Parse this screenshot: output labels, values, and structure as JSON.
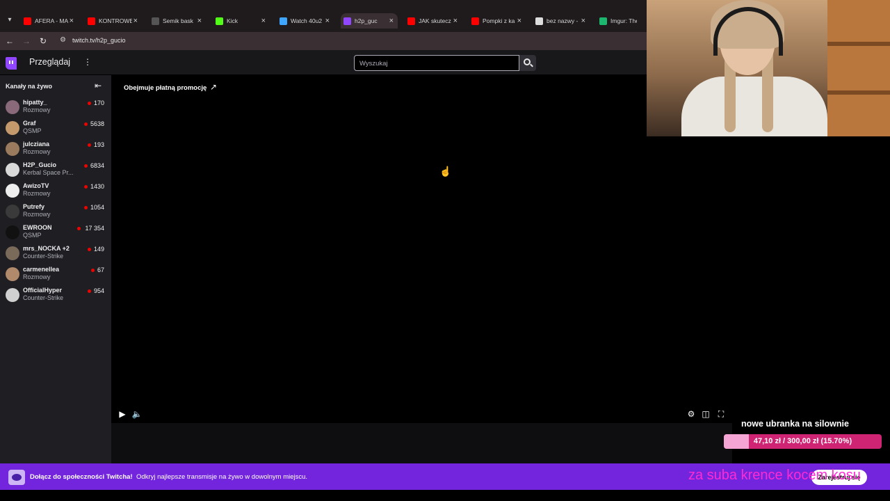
{
  "browser": {
    "tabs": [
      {
        "label": "AFERA - MA",
        "color": "#ff0000"
      },
      {
        "label": "KONTROWE",
        "color": "#ff0000"
      },
      {
        "label": "Semik bask",
        "color": "#555555"
      },
      {
        "label": "Kick",
        "color": "#53fc18"
      },
      {
        "label": "Watch 40u2",
        "color": "#3ea6ff"
      },
      {
        "label": "h2p_guc",
        "color": "#9146ff"
      },
      {
        "label": "JAK skutecz",
        "color": "#ff0000"
      },
      {
        "label": "Pompki z ka",
        "color": "#ff0000"
      },
      {
        "label": "bez nazwy -",
        "color": "#dddddd"
      },
      {
        "label": "Imgur: The",
        "color": "#1bb76e"
      }
    ],
    "url": "twitch.tv/h2p_gucio"
  },
  "topnav": {
    "browse": "Przeglądaj",
    "search_placeholder": "Wyszukaj"
  },
  "sidebar": {
    "title": "Kanały na żywo",
    "channels": [
      {
        "name": "hipatty_",
        "game": "Rozmowy",
        "viewers": "170",
        "avatar": "#8a6a7a"
      },
      {
        "name": "Graf",
        "game": "QSMP",
        "viewers": "5638",
        "avatar": "#c49a6c"
      },
      {
        "name": "julcziana",
        "game": "Rozmowy",
        "viewers": "193",
        "avatar": "#9a7b5e"
      },
      {
        "name": "H2P_Gucio",
        "game": "Kerbal Space Pr...",
        "viewers": "6834",
        "avatar": "#d9d9d9"
      },
      {
        "name": "AwizoTV",
        "game": "Rozmowy",
        "viewers": "1430",
        "avatar": "#eeeeee"
      },
      {
        "name": "Putrefy",
        "game": "Rozmowy",
        "viewers": "1054",
        "avatar": "#3a3a3a"
      },
      {
        "name": "EWROON",
        "game": "QSMP",
        "viewers": "17 354",
        "avatar": "#111111"
      },
      {
        "name": "mrs_NOCKA +2",
        "game": "Counter-Strike",
        "viewers": "149",
        "avatar": "#7a6a5a"
      },
      {
        "name": "carmenellea",
        "game": "Rozmowy",
        "viewers": "67",
        "avatar": "#b08a6a"
      },
      {
        "name": "OfficialHyper",
        "game": "Counter-Strike",
        "viewers": "954",
        "avatar": "#d0d0d0"
      }
    ]
  },
  "video": {
    "promo": "Obejmuje płatną promocję"
  },
  "goal": {
    "title": "nowe ubranka na silownie",
    "text": "47,10 zł / 300,00 zł (15.70%)",
    "fraction": 0.157
  },
  "banner": {
    "strong": "Dołącz do społeczności Twitcha!",
    "text": "Odkryj najlepsze transmisje na żywo w dowolnym miejscu.",
    "button": "Zarejestruj się"
  },
  "ticker": "za suba krence kocem kosu",
  "colors": {
    "twitch_purple": "#9146ff",
    "banner": "#7325dd",
    "live_dot": "#eb0400",
    "goal_bar": "#cf2373"
  }
}
